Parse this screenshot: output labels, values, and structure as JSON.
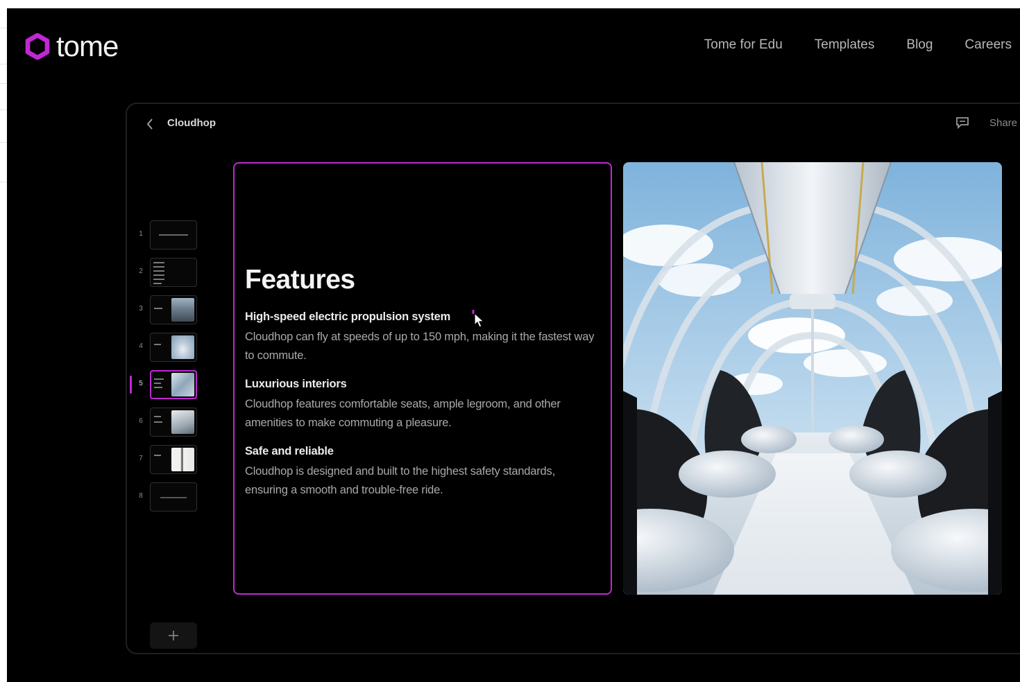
{
  "brand": {
    "name": "tome",
    "accent": "#c128d4"
  },
  "nav": [
    {
      "label": "Tome for Edu"
    },
    {
      "label": "Templates"
    },
    {
      "label": "Blog"
    },
    {
      "label": "Careers"
    }
  ],
  "editor": {
    "doc_title": "Cloudhop",
    "share_label": "Share",
    "icons": {
      "back": "chevron-left-icon",
      "comment": "comment-icon",
      "add": "plus-icon"
    }
  },
  "thumbnails": {
    "numbers": [
      "1",
      "2",
      "3",
      "4",
      "5",
      "6",
      "7",
      "8"
    ],
    "active_index": 5
  },
  "slide": {
    "title": "Features",
    "features": [
      {
        "heading": "High-speed electric propulsion system",
        "body": "Cloudhop can fly at speeds of up to 150 mph, making it the fastest way to commute."
      },
      {
        "heading": "Luxurious interiors",
        "body": "Cloudhop features comfortable seats, ample legroom, and other amenities to make commuting a pleasure."
      },
      {
        "heading": "Safe and reliable",
        "body": "Cloudhop is designed and built to the highest safety standards, ensuring a smooth and trouble-free ride."
      }
    ]
  }
}
